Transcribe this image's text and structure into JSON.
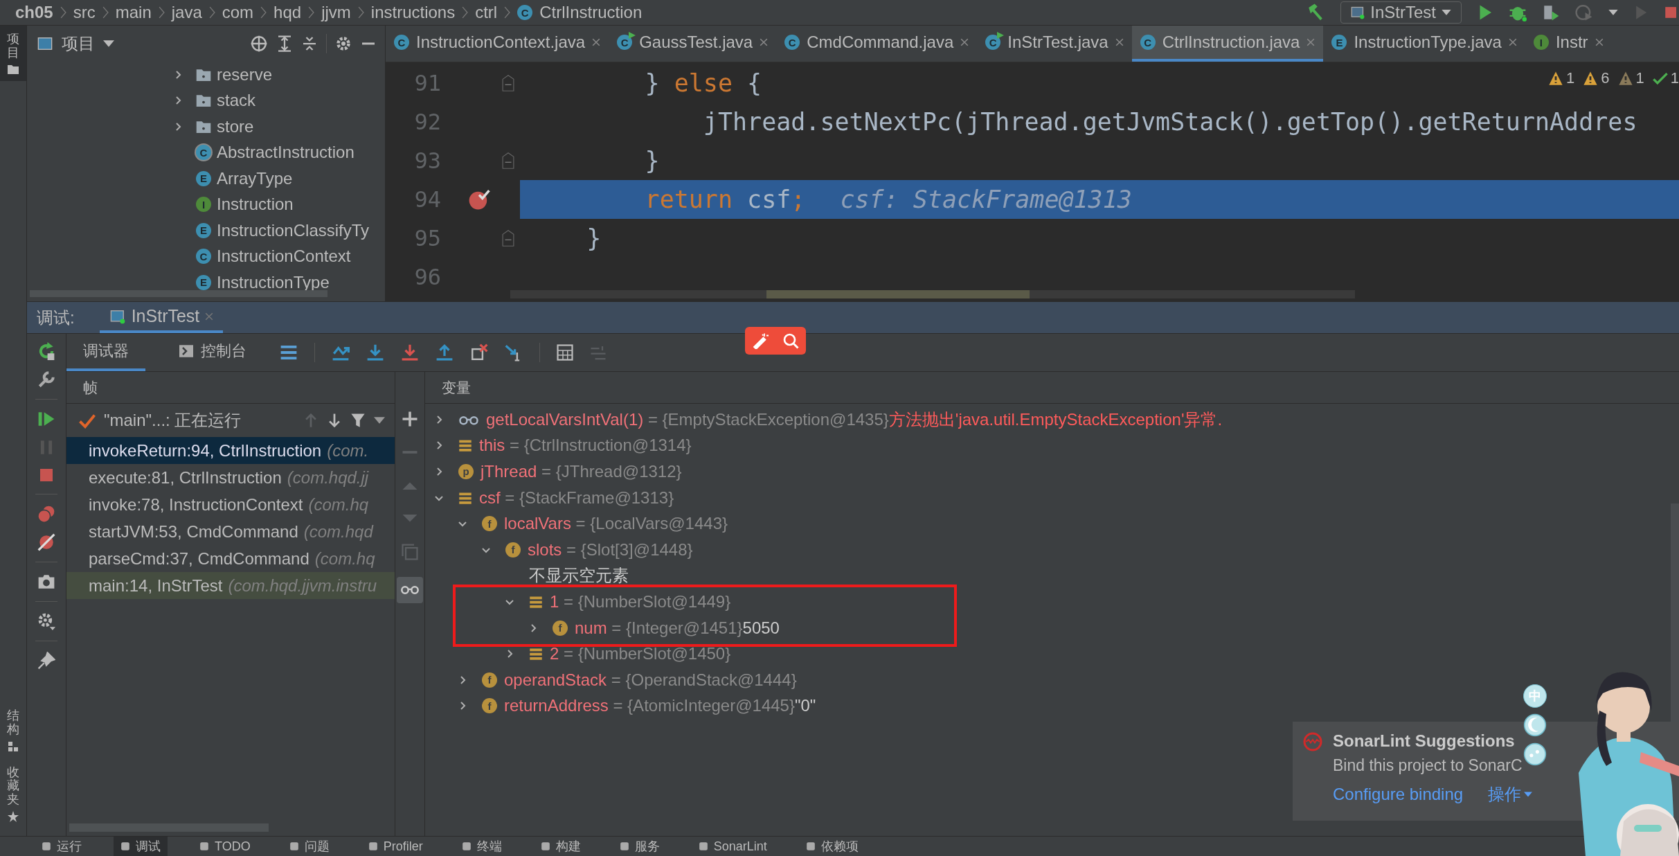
{
  "breadcrumb": {
    "items": [
      "ch05",
      "src",
      "main",
      "java",
      "com",
      "hqd",
      "jjvm",
      "instructions",
      "ctrl"
    ],
    "file": {
      "badge": "C",
      "name": "CtrlInstruction"
    }
  },
  "run_config": "InStrTest",
  "left_stripe": {
    "top": [
      {
        "label": "项目",
        "selected": true
      }
    ],
    "bottom": [
      {
        "label": "结构",
        "selected": false
      },
      {
        "label": "收藏夹",
        "selected": false
      }
    ]
  },
  "project_panel": {
    "title": "项目",
    "tree": [
      {
        "name": "reserve",
        "kind": "folder",
        "expanded": false
      },
      {
        "name": "stack",
        "kind": "folder",
        "expanded": false
      },
      {
        "name": "store",
        "kind": "folder",
        "expanded": false
      },
      {
        "name": "AbstractInstruction",
        "kind": "abstract",
        "badge": "C"
      },
      {
        "name": "ArrayType",
        "kind": "enum",
        "badge": "E"
      },
      {
        "name": "Instruction",
        "kind": "interface",
        "badge": "I"
      },
      {
        "name": "InstructionClassifyTy",
        "kind": "enum",
        "badge": "E"
      },
      {
        "name": "InstructionContext",
        "kind": "class",
        "badge": "C"
      },
      {
        "name": "InstructionType",
        "kind": "enum",
        "badge": "E"
      }
    ]
  },
  "editor_tabs": [
    {
      "label": "InstructionContext.java",
      "kind": "class",
      "badge": "C",
      "selected": false
    },
    {
      "label": "GaussTest.java",
      "kind": "runnable",
      "badge": "C",
      "selected": false
    },
    {
      "label": "CmdCommand.java",
      "kind": "class",
      "badge": "C",
      "selected": false
    },
    {
      "label": "InStrTest.java",
      "kind": "runnable",
      "badge": "C",
      "selected": false
    },
    {
      "label": "CtrlInstruction.java",
      "kind": "class",
      "badge": "C",
      "selected": true
    },
    {
      "label": "InstructionType.java",
      "kind": "enum",
      "badge": "E",
      "selected": false
    },
    {
      "label": "Instr",
      "kind": "interface",
      "badge": "I",
      "selected": false
    }
  ],
  "inspections": [
    {
      "kind": "error",
      "count": "1"
    },
    {
      "kind": "warning",
      "count": "6"
    },
    {
      "kind": "weak",
      "count": "1"
    },
    {
      "kind": "typo",
      "count": "1"
    }
  ],
  "code_lines": [
    {
      "number": "91",
      "fold": true,
      "breakpoint": false,
      "current": false,
      "tokens": [
        {
          "text": "        } ",
          "kind": "plain"
        },
        {
          "text": "else",
          "kind": "keyword"
        },
        {
          "text": " {",
          "kind": "plain"
        }
      ]
    },
    {
      "number": "92",
      "fold": false,
      "breakpoint": false,
      "current": false,
      "tokens": [
        {
          "text": "            jThread.setNextPc(jThread.getJvmStack().getTop().getReturnAddres",
          "kind": "plain"
        }
      ]
    },
    {
      "number": "93",
      "fold": true,
      "breakpoint": false,
      "current": false,
      "tokens": [
        {
          "text": "        }",
          "kind": "plain"
        }
      ]
    },
    {
      "number": "94",
      "fold": false,
      "breakpoint": true,
      "current": true,
      "tokens": [
        {
          "text": "        return",
          "kind": "keyword"
        },
        {
          "text": " csf",
          "kind": "plain"
        },
        {
          "text": ";",
          "kind": "semicolon"
        }
      ],
      "inline_value": "csf: StackFrame@1313"
    },
    {
      "number": "95",
      "fold": true,
      "breakpoint": false,
      "current": false,
      "tokens": [
        {
          "text": "    }",
          "kind": "plain"
        }
      ]
    },
    {
      "number": "96",
      "fold": false,
      "breakpoint": false,
      "current": false
    }
  ],
  "debug": {
    "label": "调试:",
    "session": {
      "label": "InStrTest",
      "selected": true
    },
    "tabs": [
      {
        "label": "调试器",
        "kind": "debugger",
        "selected": true
      },
      {
        "label": "控制台",
        "kind": "console",
        "selected": false
      }
    ],
    "frames_title": "帧",
    "thread": "\"main\"...: 正在运行",
    "frames": [
      {
        "method": "invokeReturn:94, CtrlInstruction",
        "package": "(com.",
        "selected": true,
        "marked": false
      },
      {
        "method": "execute:81, CtrlInstruction",
        "package": "(com.hqd.jj",
        "selected": false,
        "marked": false
      },
      {
        "method": "invoke:78, InstructionContext",
        "package": "(com.hq",
        "selected": false,
        "marked": false
      },
      {
        "method": "startJVM:53, CmdCommand",
        "package": "(com.hqd",
        "selected": false,
        "marked": false
      },
      {
        "method": "parseCmd:37, CmdCommand",
        "package": "(com.hq",
        "selected": false,
        "marked": false
      },
      {
        "method": "main:14, InStrTest",
        "package": "(com.hqd.jjvm.instru",
        "selected": false,
        "marked": true
      }
    ],
    "variables_title": "变量",
    "variables": [
      {
        "kind": "watch",
        "name": "getLocalVarsIntVal(1)",
        "value": "= {EmptyStackException@1435}",
        "note": "方法抛出'java.util.EmptyStackException'异常.",
        "expanded": false
      },
      {
        "kind": "var",
        "name": "this",
        "value": "= {CtrlInstruction@1314}",
        "expanded": false
      },
      {
        "kind": "param",
        "badge": "p",
        "name": "jThread",
        "value": "= {JThread@1312}",
        "expanded": false
      },
      {
        "kind": "var",
        "name": "csf",
        "value": "= {StackFrame@1313}",
        "expanded": true,
        "children": [
          {
            "kind": "field",
            "badge": "f",
            "name": "localVars",
            "value": "= {LocalVars@1443}",
            "expanded": true,
            "children": [
              {
                "kind": "field",
                "badge": "f",
                "name": "slots",
                "value": "= {Slot[3]@1448}",
                "expanded": true,
                "children": [
                  {
                    "kind": "info",
                    "name": "不显示空元素"
                  },
                  {
                    "kind": "var",
                    "name": "1",
                    "value": "= {NumberSlot@1449}",
                    "expanded": true,
                    "annotated": true,
                    "children": [
                      {
                        "kind": "field",
                        "badge": "f",
                        "name": "num",
                        "value": "= {Integer@1451}",
                        "extra": "5050",
                        "expanded": false
                      }
                    ]
                  },
                  {
                    "kind": "var",
                    "name": "2",
                    "value": "= {NumberSlot@1450}",
                    "expanded": false
                  }
                ]
              }
            ]
          },
          {
            "kind": "field",
            "badge": "f",
            "name": "operandStack",
            "value": "= {OperandStack@1444}",
            "expanded": false
          },
          {
            "kind": "field",
            "badge": "f",
            "name": "returnAddress",
            "value": "= {AtomicInteger@1445}",
            "extra": "\"0\"",
            "expanded": false
          }
        ]
      }
    ]
  },
  "notification": {
    "title": "SonarLint Suggestions",
    "body": "Bind this project to SonarC",
    "actions": [
      {
        "label": "Configure binding",
        "kind": "link"
      },
      {
        "label": "操作",
        "kind": "menu"
      }
    ]
  },
  "ime_badge": "中",
  "tool_windows": [
    {
      "label": "运行",
      "selected": false
    },
    {
      "label": "调试",
      "selected": true
    },
    {
      "label": "TODO",
      "selected": false
    },
    {
      "label": "问题",
      "selected": false
    },
    {
      "label": "Profiler",
      "selected": false
    },
    {
      "label": "终端",
      "selected": false
    },
    {
      "label": "构建",
      "selected": false
    },
    {
      "label": "服务",
      "selected": false
    },
    {
      "label": "SonarLint",
      "selected": false
    },
    {
      "label": "依赖项",
      "selected": false
    }
  ]
}
